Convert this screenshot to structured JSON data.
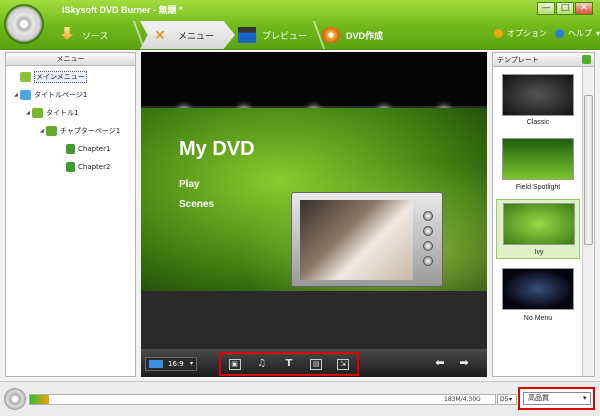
{
  "app": {
    "title": "iSkysoft DVD Burner - 無題 *"
  },
  "window": {
    "minimize": "—",
    "maximize": "□",
    "close": "✕"
  },
  "tabs": [
    {
      "label": "ソース",
      "icon": "download-icon"
    },
    {
      "label": "メニュー",
      "icon": "wand-tools-icon"
    },
    {
      "label": "プレビュー",
      "icon": "clapper-icon"
    },
    {
      "label": "DVD作成",
      "icon": "dvd-burn-icon"
    }
  ],
  "header": {
    "options": "オプション",
    "help": "ヘルプ"
  },
  "menu_tree": {
    "title": "メニュー",
    "items": [
      {
        "label": "メインメニュー",
        "icon": "home-icon",
        "level": 0
      },
      {
        "label": "タイトルページ1",
        "icon": "monitor-icon",
        "level": 0
      },
      {
        "label": "タイトル1",
        "icon": "folder-icon",
        "level": 1
      },
      {
        "label": "チャプターページ1",
        "icon": "filmstrip-icon",
        "level": 2
      },
      {
        "label": "Chapter1",
        "icon": "film-icon",
        "level": 3
      },
      {
        "label": "Chapter2",
        "icon": "film-icon",
        "level": 3
      }
    ]
  },
  "preview": {
    "title": "My DVD",
    "items": [
      "Play",
      "Scenes"
    ]
  },
  "controls": {
    "aspect": "16:9"
  },
  "templates": {
    "title": "テンプレート",
    "items": [
      {
        "label": "Classic",
        "selected": false
      },
      {
        "label": "Field Spotlight",
        "selected": false
      },
      {
        "label": "Ivy",
        "selected": true
      },
      {
        "label": "No Menu",
        "selected": false
      }
    ]
  },
  "status": {
    "capacity": "183M/4.30G",
    "capacity_fraction": 0.04,
    "disc": "D5",
    "quality": "高品質"
  }
}
